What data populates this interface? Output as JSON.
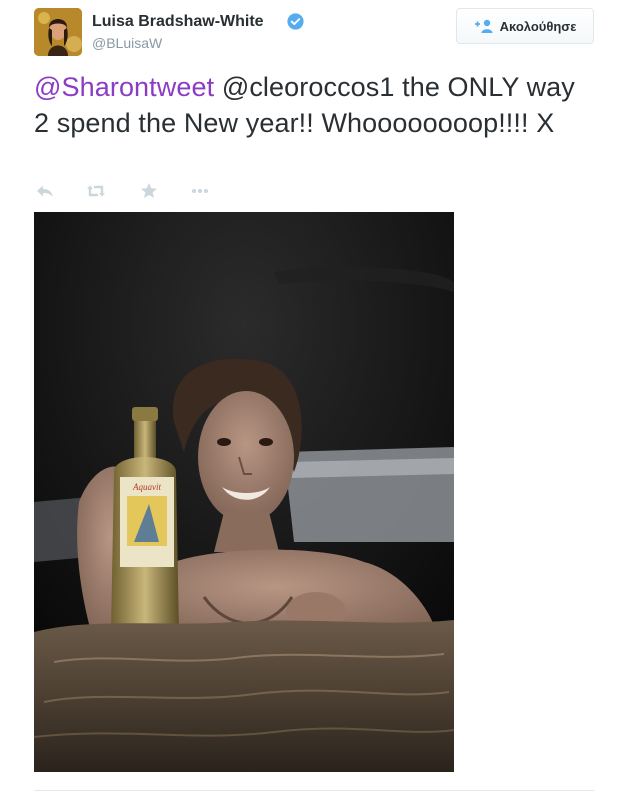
{
  "author": {
    "fullname": "Luisa Bradshaw-White",
    "username": "@BLuisaW",
    "verified": true
  },
  "follow_button": {
    "label": "Ακολούθησε"
  },
  "tweet": {
    "mention_1": "@Sharontweet",
    "text_rest": " @cleoroccos1 the ONLY way 2 spend the New year!! Whoooooooop!!!! X"
  },
  "actions": [
    "reply-icon",
    "retweet-icon",
    "favorite-icon",
    "more-icon"
  ],
  "media": {
    "bottle_label_text": "Aquavit"
  },
  "colors": {
    "mention": "#8c3cc4",
    "text": "#292f33",
    "secondary": "#8899a6",
    "verified": "#55acee",
    "action_icons": "#ccd6dd"
  }
}
